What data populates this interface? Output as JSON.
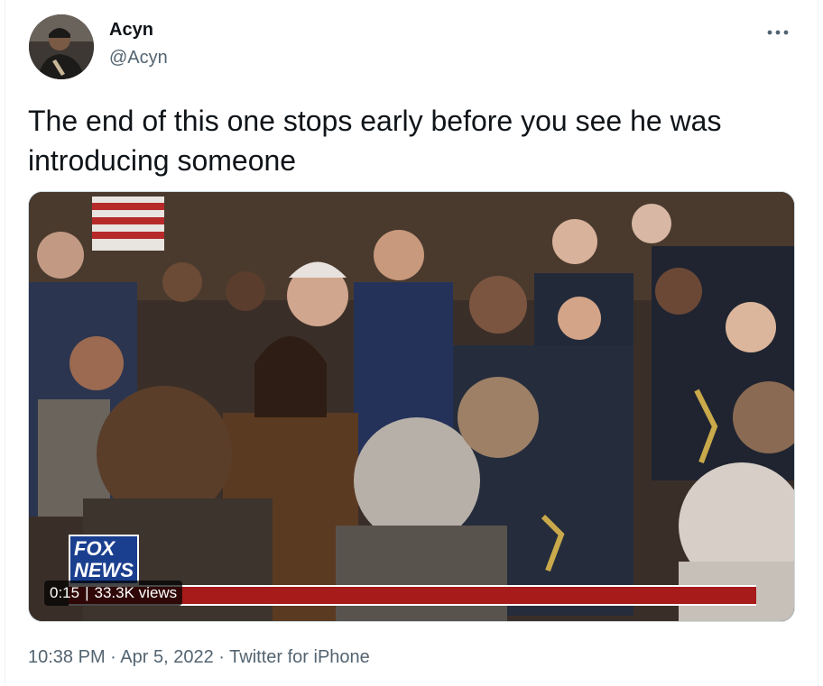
{
  "tweet": {
    "author": {
      "display_name": "Acyn",
      "handle": "@Acyn"
    },
    "more_icon": "more-horizontal-icon",
    "text": "The end of this one stops early before you see he was introducing someone",
    "media": {
      "type": "video",
      "timestamp": "0:15",
      "separator": "|",
      "views": "33.3K views",
      "overlay_logo": "FOX NEWS"
    },
    "meta": {
      "time": "10:38 PM",
      "dot1": "·",
      "date": "Apr 5, 2022",
      "dot2": "·",
      "source": "Twitter for iPhone"
    }
  },
  "colors": {
    "text_primary": "#0f1419",
    "text_secondary": "#536471",
    "border": "#cfd9de",
    "fox_blue": "#1b3f8f",
    "ticker_red": "#a81b1b"
  }
}
